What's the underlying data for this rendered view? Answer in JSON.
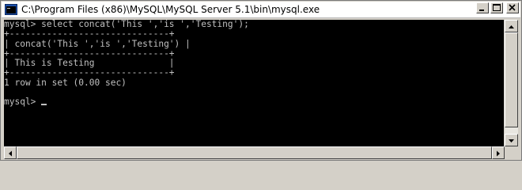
{
  "window": {
    "title": "C:\\Program Files (x86)\\MySQL\\MySQL Server 5.1\\bin\\mysql.exe",
    "icon": "console-app-icon"
  },
  "titlebar_buttons": [
    {
      "name": "minimize-button",
      "icon": "minimize-icon"
    },
    {
      "name": "maximize-button",
      "icon": "maximize-icon"
    },
    {
      "name": "close-button",
      "icon": "close-icon"
    }
  ],
  "console": {
    "lines": [
      "mysql> select concat('This ','is ','Testing');",
      "+------------------------------+",
      "| concat('This ','is ','Testing') |",
      "+------------------------------+",
      "| This is Testing              |",
      "+------------------------------+",
      "1 row in set (0.00 sec)",
      "",
      "mysql> "
    ]
  },
  "colors": {
    "console_bg": "#000000",
    "console_fg": "#c0c0c0",
    "chrome": "#d4d0c8"
  }
}
